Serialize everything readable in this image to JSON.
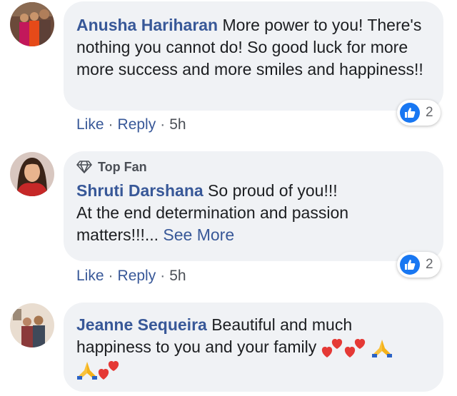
{
  "comments": [
    {
      "author": "Anusha Hariharan",
      "text": "More power to you! There's nothing you cannot do! So good luck for more more success and more smiles and happiness!!",
      "actions": {
        "like": "Like",
        "reply": "Reply",
        "time": "5h"
      },
      "reaction_count": "2"
    },
    {
      "badge": "Top Fan",
      "author": "Shruti Darshana",
      "text_line1": "So proud of you!!!",
      "text_line2": "At the end determination and passion",
      "text_line3": "matters!!!...",
      "see_more": "See More",
      "actions": {
        "like": "Like",
        "reply": "Reply",
        "time": "5h"
      },
      "reaction_count": "2"
    },
    {
      "author": "Jeanne Sequeira",
      "text_line1": "Beautiful and much",
      "text_line2": "happiness to you and your family",
      "emoji_row1": [
        "two-hearts-icon",
        "two-hearts-icon",
        "folded-hands-icon"
      ],
      "emoji_row2": [
        "folded-hands-icon",
        "two-hearts-icon"
      ]
    }
  ],
  "colors": {
    "author": "#385898",
    "bubble": "#f0f2f5",
    "like_blue": "#1877f2"
  }
}
